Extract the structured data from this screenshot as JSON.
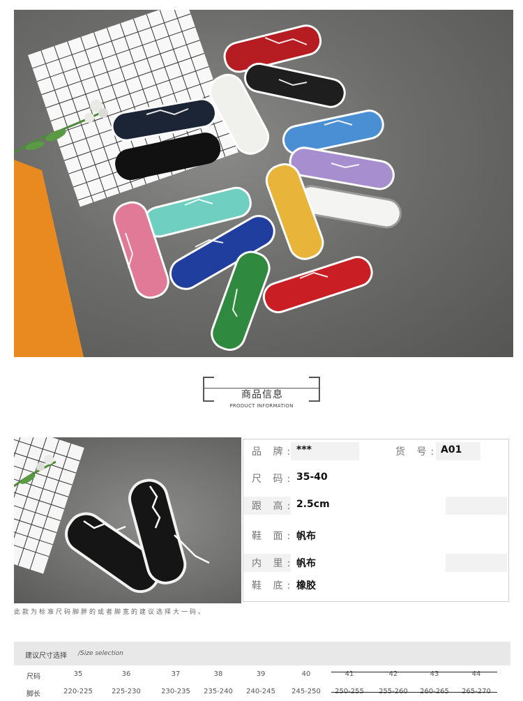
{
  "section_title": {
    "cn": "商品信息",
    "en": "PRODUCT INFORMATION"
  },
  "specs": [
    {
      "label": "品 牌:",
      "value": "***",
      "label2": "货 号:",
      "value2": "A01"
    },
    {
      "label": "尺 码:",
      "value": "35-40"
    },
    {
      "label": "跟 高:",
      "value": "2.5cm"
    },
    {
      "label": "鞋 面:",
      "value": "帆布"
    },
    {
      "label": "内 里:",
      "value": "帆布"
    },
    {
      "label": "鞋 底:",
      "value": "橡胶"
    }
  ],
  "note": "此款为标准尺码脚胖的或者脚宽的建议选择大一码。",
  "size_table": {
    "title_cn": "建议尺寸选择",
    "title_en": "/Size selection",
    "size_label": "尺码",
    "length_label": "脚长",
    "sizes": [
      "35",
      "36",
      "37",
      "38",
      "39",
      "40",
      "41",
      "42",
      "43",
      "44"
    ],
    "lengths": [
      "220-225",
      "225-230",
      "230-235",
      "235-240",
      "240-245",
      "245-250",
      "250-255",
      "255-260",
      "260-265",
      "265-270"
    ]
  },
  "shoe_colors": [
    "#b51d22",
    "#1e1e1e",
    "#f0f0ec",
    "#1c2535",
    "#4a8fd4",
    "#a78fcf",
    "#6fcfc0",
    "#e8b53a",
    "#f4f4f2",
    "#e07a96",
    "#1f3e9e",
    "#2f8a3f",
    "#c81e24",
    "#111111"
  ],
  "icons": [
    "shoes-flatlay-photo",
    "grid-board-photo",
    "flower-sprig-photo",
    "black-sneakers-photo"
  ]
}
